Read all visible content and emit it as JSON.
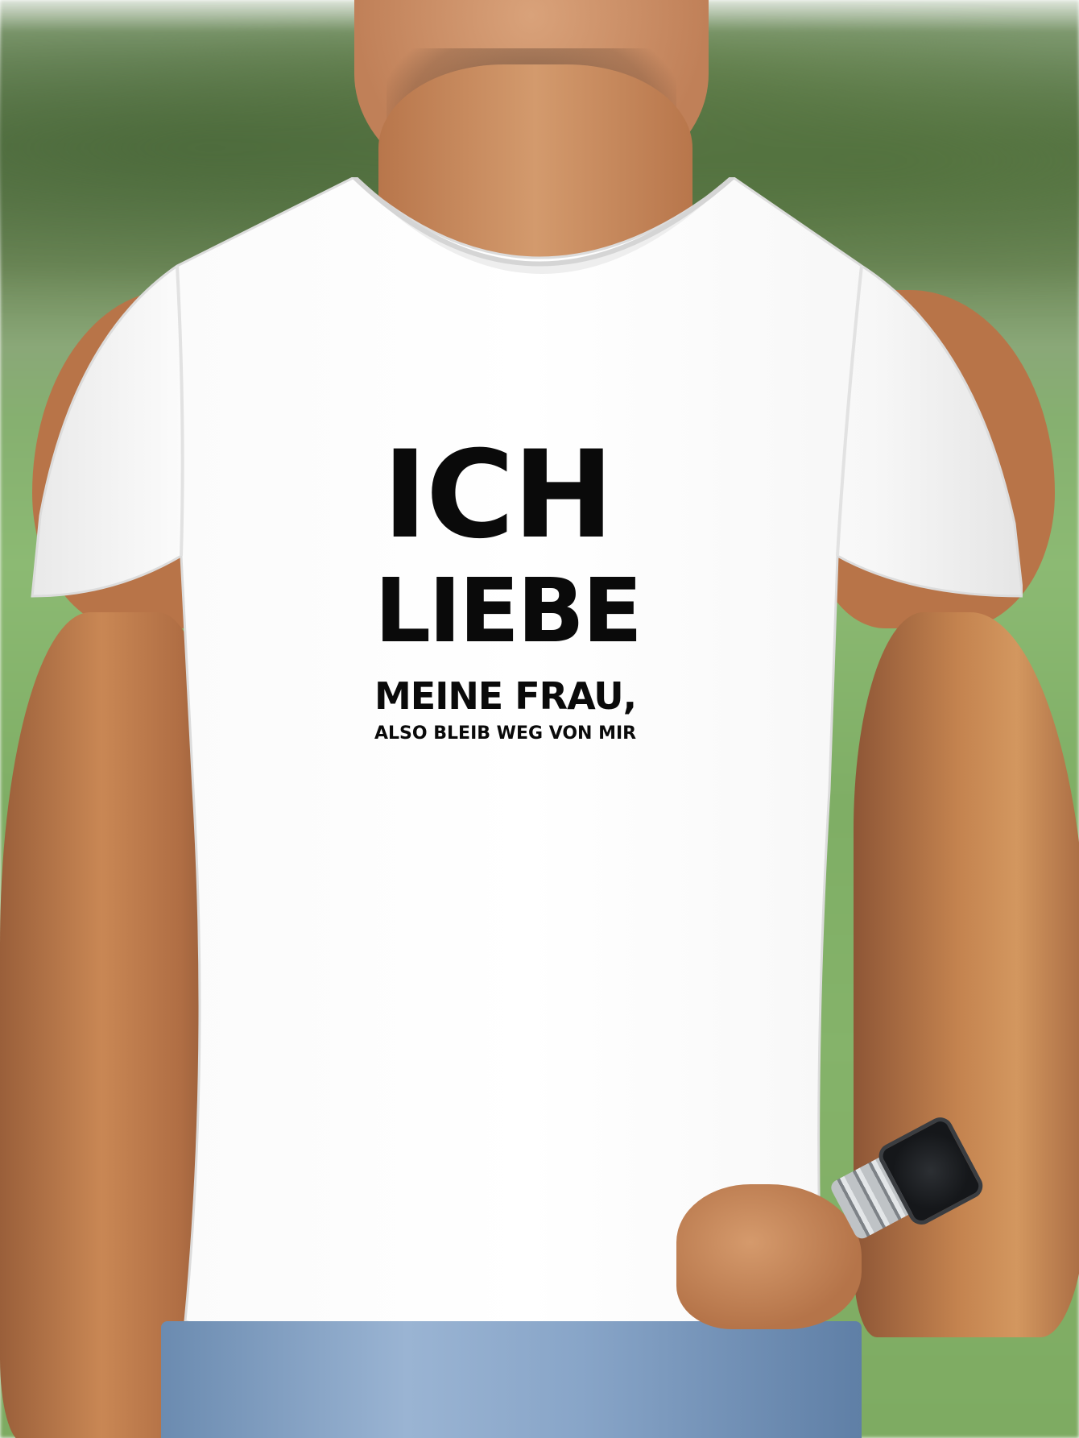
{
  "photo": {
    "shirt_print": {
      "line1": "ICH",
      "line2": "LIEBE",
      "line3": "MEINE FRAU,",
      "line4": "ALSO BLEIB WEG VON MIR"
    },
    "colors": {
      "shirt": "#ffffff",
      "print": "#0a0a0a",
      "grass": "#86b36b",
      "skin": "#c98a5e",
      "jeans": "#88a5c8"
    }
  }
}
